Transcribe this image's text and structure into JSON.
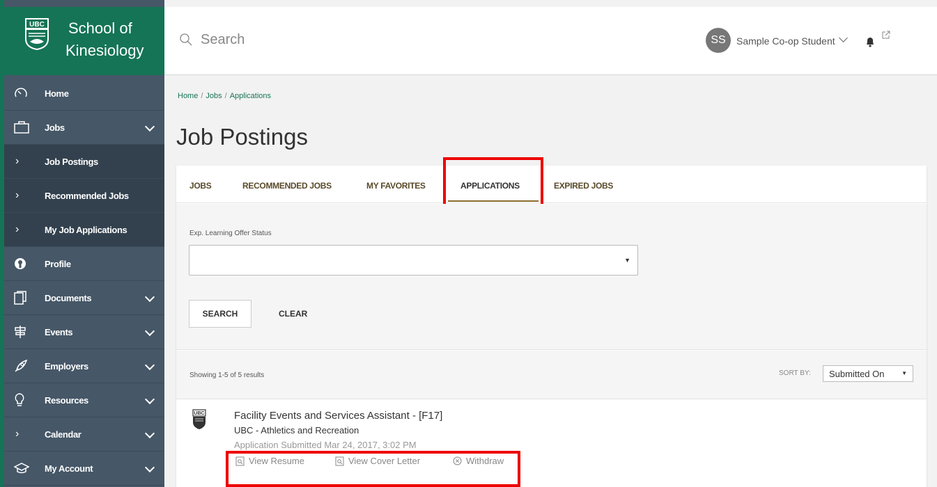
{
  "brand": {
    "line1": "School of",
    "line2": "Kinesiology"
  },
  "colors": {
    "brand_green": "#157455",
    "sidebar": "#465767",
    "highlight": "#ee0000"
  },
  "search": {
    "placeholder": "Search"
  },
  "user": {
    "initials": "SS",
    "name": "Sample Co-op Student"
  },
  "nav": {
    "home": "Home",
    "jobs": "Jobs",
    "job_postings": "Job Postings",
    "recommended_jobs": "Recommended Jobs",
    "my_job_applications": "My Job Applications",
    "profile": "Profile",
    "documents": "Documents",
    "events": "Events",
    "employers": "Employers",
    "resources": "Resources",
    "calendar": "Calendar",
    "my_account": "My Account"
  },
  "breadcrumb": {
    "home": "Home",
    "jobs": "Jobs",
    "applications": "Applications",
    "sep": "/"
  },
  "page_title": "Job Postings",
  "tabs": {
    "jobs": "JOBS",
    "recommended": "RECOMMENDED JOBS",
    "favorites": "MY FAVORITES",
    "applications": "APPLICATIONS",
    "expired": "EXPIRED JOBS"
  },
  "filter": {
    "label": "Exp. Learning Offer Status",
    "value": ""
  },
  "buttons": {
    "search": "SEARCH",
    "clear": "CLEAR"
  },
  "results": {
    "showing": "Showing 1-5 of 5 results",
    "sort_label": "SORT BY:",
    "sort_value": "Submitted On"
  },
  "application": {
    "title": "Facility Events and Services Assistant - [F17]",
    "employer": "UBC - Athletics and Recreation",
    "submitted": "Application Submitted Mar 24, 2017, 3:02 PM",
    "actions": {
      "view_resume": "View Resume",
      "view_cover_letter": "View Cover Letter",
      "withdraw": "Withdraw"
    }
  }
}
